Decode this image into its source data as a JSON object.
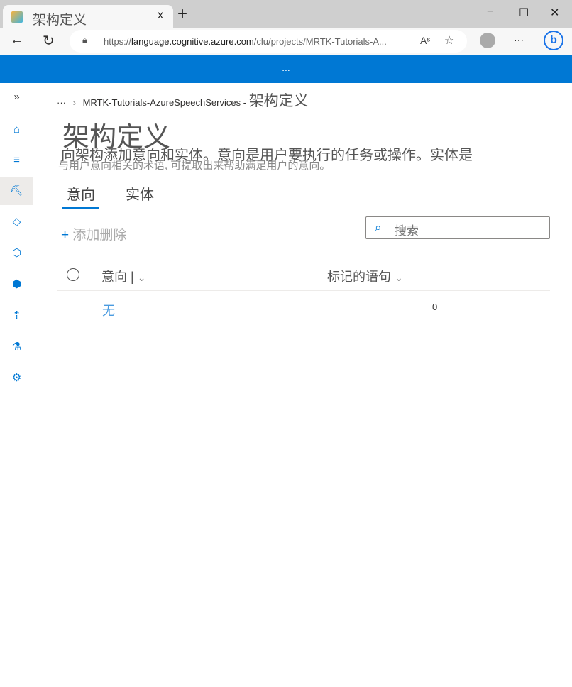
{
  "browser": {
    "tab_title": "架构定义",
    "url_prefix": "https://",
    "url_domain": "language.cognitive.azure.com",
    "url_path": "/clu/projects/MRTK-Tutorials-A...",
    "close": "x",
    "new_tab": "+",
    "minimize": "−",
    "maximize": "☐",
    "close_window": "✕",
    "more": "···",
    "read_aloud": "Aˢ"
  },
  "banner": {
    "text": "..."
  },
  "breadcrumb": {
    "ellipsis": "···",
    "project": "MRTK-Tutorials-AzureSpeechServices -",
    "current": "架构定义"
  },
  "page": {
    "title": "架构定义",
    "description_line1": "向架构添加意向和实体。意向是用户要执行的任务或操作。实体是",
    "description_line2": "与用户意向相关的术语, 可提取出来帮助满足用户的意向。"
  },
  "tabs": [
    {
      "label": "意向"
    },
    {
      "label": "实体"
    }
  ],
  "toolbar": {
    "add": "添加",
    "delete": "删除",
    "search_placeholder": "搜索"
  },
  "table": {
    "columns": [
      "意向 |",
      "标记的语句"
    ],
    "rows": [
      {
        "intent": "无",
        "utterances": "0"
      }
    ]
  }
}
